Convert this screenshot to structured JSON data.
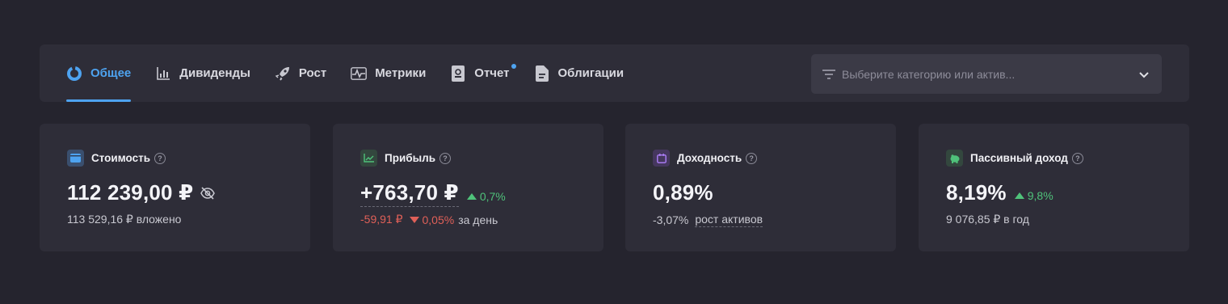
{
  "tabs": [
    {
      "label": "Общее",
      "icon": "donut-chart-icon",
      "active": true
    },
    {
      "label": "Дивиденды",
      "icon": "bar-chart-icon"
    },
    {
      "label": "Рост",
      "icon": "rocket-icon"
    },
    {
      "label": "Метрики",
      "icon": "pulse-icon"
    },
    {
      "label": "Отчет",
      "icon": "report-icon",
      "notification_dot": true
    },
    {
      "label": "Облигации",
      "icon": "document-icon"
    }
  ],
  "asset_select": {
    "placeholder": "Выберите категорию или актив...",
    "icon": "filter-icon"
  },
  "cards": {
    "value": {
      "title": "Стоимость",
      "amount": "112 239,00 ₽",
      "sub": "113 529,16 ₽ вложено"
    },
    "profit": {
      "title": "Прибыль",
      "amount": "+763,70 ₽",
      "change": "0,7%",
      "day_amount": "-59,91 ₽",
      "day_change": "0,05%",
      "day_label": "за день"
    },
    "yield": {
      "title": "Доходность",
      "amount": "0,89%",
      "sub_value": "-3,07%",
      "sub_link": "рост активов"
    },
    "passive": {
      "title": "Пассивный доход",
      "amount": "8,19%",
      "change": "9,8%",
      "sub": "9 076,85 ₽ в год"
    }
  },
  "colors": {
    "accent": "#4ea3f0",
    "positive": "#4fc27a",
    "negative": "#e06058",
    "background": "#25242e",
    "panel": "#2e2d38"
  }
}
